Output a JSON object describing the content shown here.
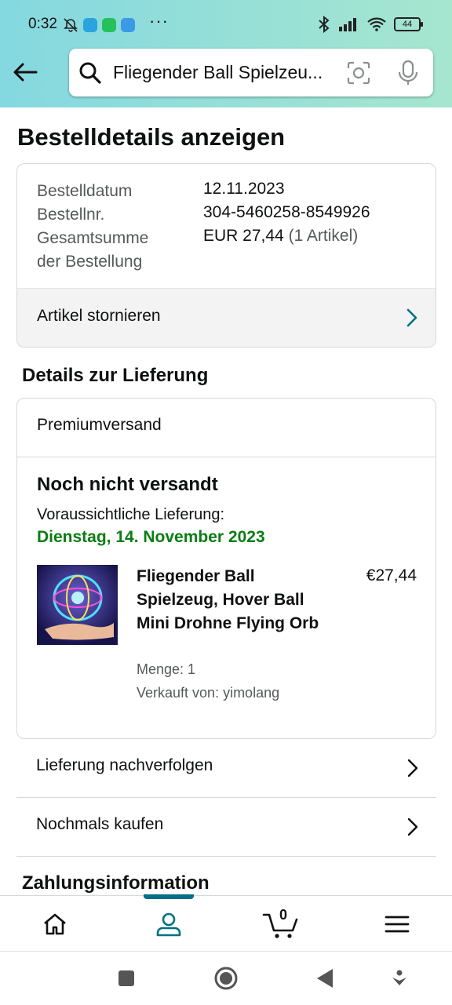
{
  "status_bar": {
    "time": "0:32",
    "more": "···",
    "battery": "44"
  },
  "search": {
    "value": "Fliegender Ball Spielzeu..."
  },
  "page": {
    "title": "Bestelldetails anzeigen"
  },
  "order": {
    "date_label": "Bestelldatum",
    "date_value": "12.11.2023",
    "number_label": "Bestellnr.",
    "number_value": "304-5460258-8549926",
    "total_label_1": "Gesamtsumme",
    "total_label_2": "der Bestellung",
    "total_value": "EUR 27,44",
    "total_count": "(1 Artikel)",
    "cancel_label": "Artikel stornieren"
  },
  "delivery": {
    "section_title": "Details zur Lieferung",
    "shipping_method": "Premiumversand",
    "status": "Noch nicht versandt",
    "eta_label": "Voraussichtliche Lieferung:",
    "eta_date": "Dienstag, 14. November 2023",
    "product": {
      "title": "Fliegender Ball Spielzeug, Hover Ball Mini Drohne Flying Orb",
      "price": "€27,44",
      "quantity": "Menge: 1",
      "seller": "Verkauft von: yimolang"
    }
  },
  "actions": {
    "track": "Lieferung nachverfolgen",
    "buy_again": "Nochmals kaufen"
  },
  "payment": {
    "section_title": "Zahlungsinformation"
  },
  "bottom_nav": {
    "cart_count": "0",
    "active": "account"
  },
  "colors": {
    "header_from": "#84d8e0",
    "header_to": "#a6e6cf",
    "accent": "#007185",
    "delivery_green": "#0a7d13"
  }
}
